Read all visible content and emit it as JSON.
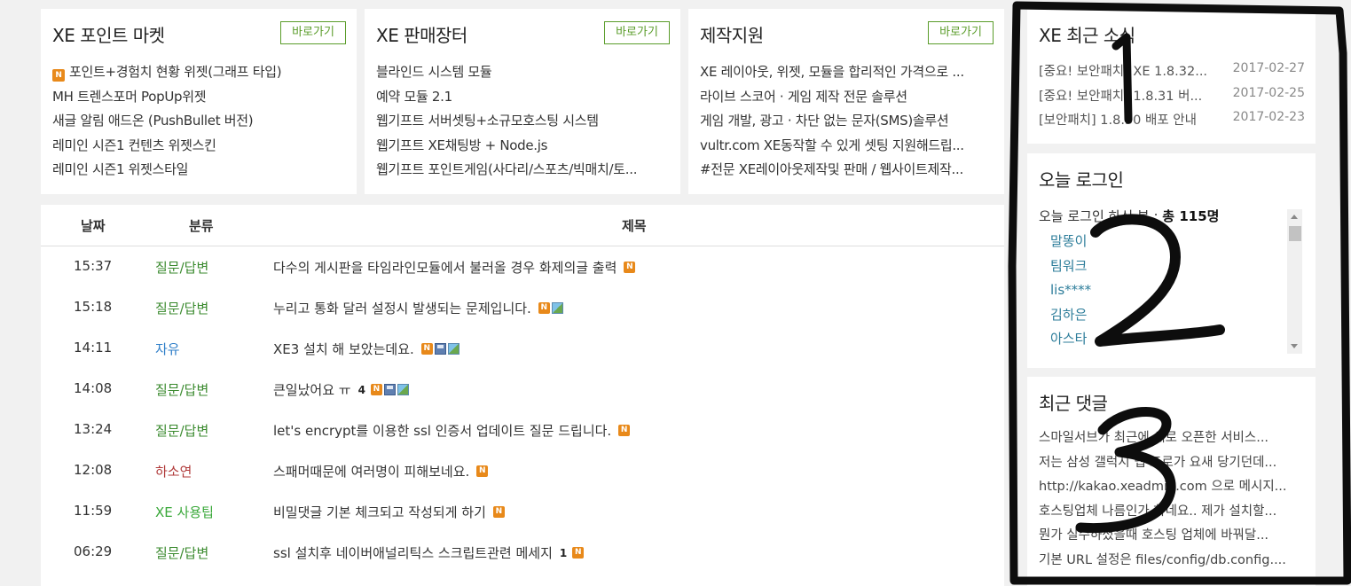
{
  "boxes": [
    {
      "title": "XE 포인트 마켓",
      "button": "바로가기",
      "items": [
        {
          "text": "포인트+경험치 현황 위젯(그래프 타입)",
          "new": true
        },
        {
          "text": "MH 트렌스포머 PopUp위젯",
          "new": false
        },
        {
          "text": "새글 알림 애드온 (PushBullet 버전)",
          "new": false
        },
        {
          "text": "레미인 시즌1 컨텐츠 위젯스킨",
          "new": false
        },
        {
          "text": "레미인 시즌1 위젯스타일",
          "new": false
        }
      ]
    },
    {
      "title": "XE 판매장터",
      "button": "바로가기",
      "items": [
        {
          "text": "블라인드 시스템 모듈"
        },
        {
          "text": "예약 모듈 2.1"
        },
        {
          "text": "웹기프트 서버셋팅+소규모호스팅 시스템"
        },
        {
          "text": "웹기프트 XE채팅방 + Node.js"
        },
        {
          "text": "웹기프트 포인트게임(사다리/스포츠/빅매치/토..."
        }
      ]
    },
    {
      "title": "제작지원",
      "button": "바로가기",
      "items": [
        {
          "text": "XE 레이아웃, 위젯, 모듈을 합리적인 가격으로 ..."
        },
        {
          "text": "라이브 스코어 · 게임 제작 전문 솔루션"
        },
        {
          "text": "게임 개발, 광고 · 차단 없는 문자(SMS)솔루션"
        },
        {
          "text": "vultr.com XE동작할 수 있게 셋팅 지원해드립..."
        },
        {
          "text": "#전문 XE레이아웃제작및 판매 / 웹사이트제작..."
        }
      ]
    }
  ],
  "board": {
    "headers": {
      "date": "날짜",
      "category": "분류",
      "title": "제목"
    },
    "rows": [
      {
        "time": "15:37",
        "category": "질문/답변",
        "cat_color": "#3a8a2e",
        "title": "다수의 게시판을 타임라인모듈에서 불러올 경우 화제의글 출력",
        "comments": "",
        "icons": [
          "n"
        ]
      },
      {
        "time": "15:18",
        "category": "질문/답변",
        "cat_color": "#3a8a2e",
        "title": "누리고 통화 달러 설정시 발생되는 문제입니다.",
        "comments": "",
        "icons": [
          "n",
          "img"
        ]
      },
      {
        "time": "14:11",
        "category": "자유",
        "cat_color": "#2f7fc9",
        "title": "XE3 설치 해 보았는데요.",
        "comments": "",
        "icons": [
          "n",
          "disk",
          "img"
        ]
      },
      {
        "time": "14:08",
        "category": "질문/답변",
        "cat_color": "#3a8a2e",
        "title": "큰일났어요 ㅠ",
        "comments": "4",
        "icons": [
          "n",
          "disk",
          "img"
        ]
      },
      {
        "time": "13:24",
        "category": "질문/답변",
        "cat_color": "#3a8a2e",
        "title": "let's encrypt를 이용한 ssl 인증서 업데이트 질문 드립니다.",
        "comments": "",
        "icons": [
          "n"
        ]
      },
      {
        "time": "12:08",
        "category": "하소연",
        "cat_color": "#b03a3a",
        "title": "스패머때문에 여러명이 피해보네요.",
        "comments": "",
        "icons": [
          "n"
        ]
      },
      {
        "time": "11:59",
        "category": "XE 사용팁",
        "cat_color": "#3aa83a",
        "title": "비밀댓글 기본 체크되고 작성되게 하기",
        "comments": "",
        "icons": [
          "n"
        ]
      },
      {
        "time": "06:29",
        "category": "질문/답변",
        "cat_color": "#3a8a2e",
        "title": "ssl 설치후 네이버애널리틱스 스크립트관련 메세지",
        "comments": "1",
        "icons": [
          "n"
        ]
      }
    ]
  },
  "sidebar": {
    "news": {
      "title": "XE 최근 소식",
      "items": [
        {
          "text": "[중요! 보안패치] XE 1.8.32...",
          "date": "2017-02-27"
        },
        {
          "text": "[중요! 보안패치] 1.8.31 버...",
          "date": "2017-02-25"
        },
        {
          "text": "[보안패치] 1.8.30 배포 안내",
          "date": "2017-02-23"
        }
      ]
    },
    "login": {
      "title": "오늘 로그인",
      "label": "오늘 로그인 하신 분 : ",
      "count": "총 115명",
      "users": [
        "말똥이",
        "팀워크",
        "lis****",
        "김하은",
        "아스타"
      ]
    },
    "comments": {
      "title": "최근 댓글",
      "items": [
        "스마일서브가 최근에 새로 오픈한 서비스...",
        "저는 삼성 갤럭시 탭 프로가 요새 당기던데...",
        "http://kakao.xeadmin.com 으로 메시지...",
        "호스팅업체 나름인가 하네요.. 제가 설치할...",
        "뭔가 실수하셨을때 호스팅 업체에 바꿔달...",
        "기본 URL 설정은 files/config/db.config...."
      ]
    }
  },
  "annotations": {
    "numbers": [
      "1",
      "2",
      "3"
    ]
  }
}
